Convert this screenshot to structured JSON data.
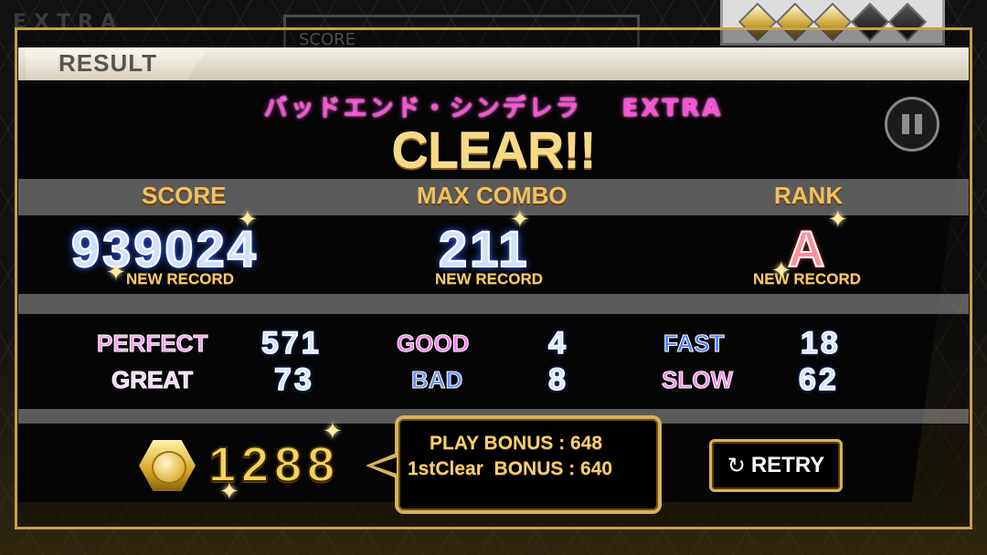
{
  "header": {
    "mode_ghost": "EXTRA",
    "result_label": "RESULT",
    "score_ghost": "SCORE"
  },
  "song": {
    "title": "バッドエンド・シンデレラ",
    "difficulty": "EXTRA"
  },
  "status": "CLEAR!!",
  "stats": {
    "score": {
      "label": "SCORE",
      "value": "939024",
      "note": "NEW RECORD"
    },
    "max_combo": {
      "label": "MAX COMBO",
      "value": "211",
      "note": "NEW RECORD"
    },
    "rank": {
      "label": "RANK",
      "value": "A",
      "note": "NEW RECORD"
    }
  },
  "judgements": {
    "perfect": {
      "label": "PERFECT",
      "value": "571"
    },
    "great": {
      "label": "GREAT",
      "value": "73"
    },
    "good": {
      "label": "GOOD",
      "value": "4"
    },
    "bad": {
      "label": "BAD",
      "value": "8"
    },
    "fast": {
      "label": "FAST",
      "value": "18"
    },
    "slow": {
      "label": "SLOW",
      "value": "62"
    }
  },
  "reward": {
    "coins": "1288",
    "play_bonus": "PLAY BONUS : 648",
    "first_clear_bonus": "1stClear  BONUS : 640"
  },
  "retry": {
    "label": "RETRY",
    "icon": "refresh-icon"
  },
  "difficulty_gauge": {
    "filled": 3,
    "total": 5
  },
  "colors": {
    "gold": "#f0c060",
    "pink": "#ff4fd8",
    "blue_glow": "#3060ff"
  }
}
